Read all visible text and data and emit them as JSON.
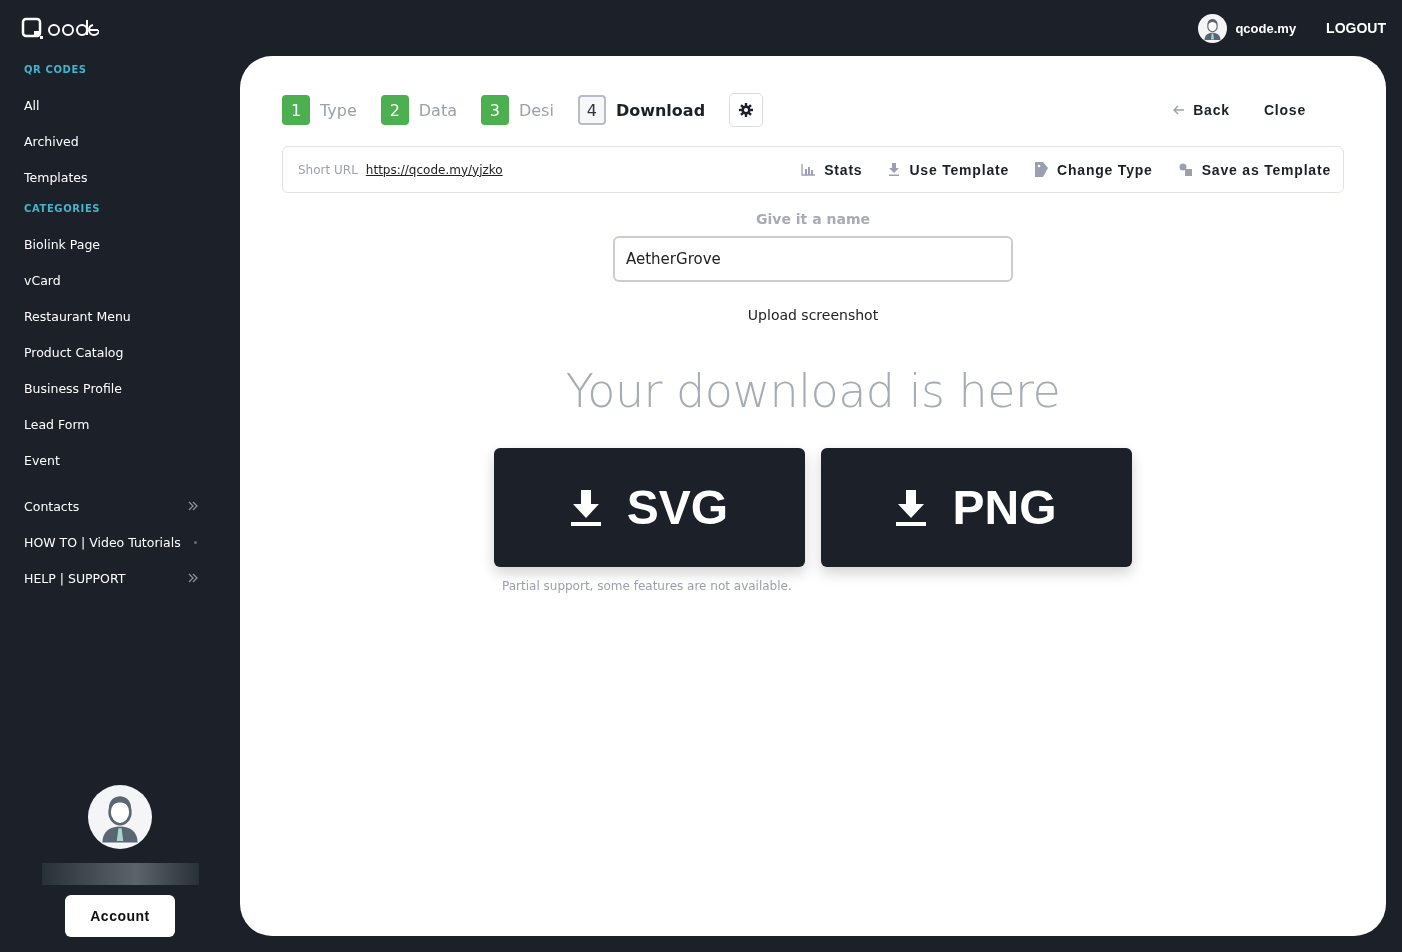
{
  "topbar": {
    "username": "qcode.my",
    "logout": "LOGOUT"
  },
  "sidebar": {
    "sections": [
      {
        "heading": "QR CODES",
        "items": [
          {
            "label": "All"
          },
          {
            "label": "Archived"
          },
          {
            "label": "Templates"
          }
        ]
      },
      {
        "heading": "CATEGORIES",
        "items": [
          {
            "label": "Biolink Page"
          },
          {
            "label": "vCard"
          },
          {
            "label": "Restaurant Menu"
          },
          {
            "label": "Product Catalog"
          },
          {
            "label": "Business Profile"
          },
          {
            "label": "Lead Form"
          },
          {
            "label": "Event"
          }
        ]
      },
      {
        "items": [
          {
            "label": "Contacts",
            "kind": "chevron"
          },
          {
            "label": "HOW TO | Video Tutorials",
            "kind": "dot"
          },
          {
            "label": "HELP | SUPPORT",
            "kind": "chevron"
          }
        ]
      }
    ],
    "account_button": "Account"
  },
  "steps": [
    {
      "number": "1",
      "label": "Type",
      "completed": true,
      "selected": false
    },
    {
      "number": "2",
      "label": "Data",
      "completed": true,
      "selected": false
    },
    {
      "number": "3",
      "label": "Desi",
      "completed": true,
      "selected": false
    },
    {
      "number": "4",
      "label": "Download",
      "completed": false,
      "selected": true
    }
  ],
  "nav": {
    "back": "Back",
    "close": "Close"
  },
  "url_bar": {
    "label": "Short URL",
    "url": "https://qcode.my/yjzko",
    "actions": [
      {
        "kind": "stats",
        "label": "Stats"
      },
      {
        "kind": "download",
        "label": "Use Template"
      },
      {
        "kind": "tag",
        "label": "Change Type"
      },
      {
        "kind": "shapes",
        "label": "Save as Template"
      }
    ]
  },
  "name_field": {
    "label": "Give it a name",
    "value": "AetherGrove"
  },
  "upload_link": "Upload screenshot",
  "download": {
    "heading": "Your download is here",
    "buttons": [
      {
        "label": "SVG"
      },
      {
        "label": "PNG"
      }
    ],
    "note": "Partial support, some features are not available."
  }
}
